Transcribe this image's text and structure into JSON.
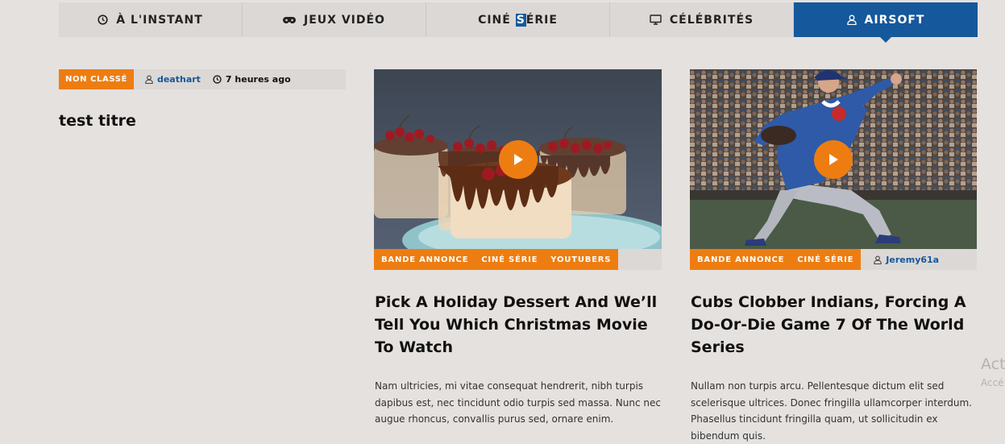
{
  "nav": {
    "tabs": [
      {
        "label": "À L'INSTANT",
        "icon": "clock-icon"
      },
      {
        "label": "JEUX VIDÉO",
        "icon": "gamepad-icon"
      },
      {
        "label_before": "CINÉ ",
        "label_hl": "S",
        "label_after": "ÉRIE"
      },
      {
        "label": "CÉLÉBRITÉS",
        "icon": "monitor-icon"
      },
      {
        "label": "AIRSOFT",
        "icon": "user-icon",
        "active": true
      }
    ]
  },
  "left_post": {
    "category": "NON CLASSÉ",
    "author": "deathart",
    "time": "7 heures ago",
    "title": "test titre"
  },
  "cards": [
    {
      "tags": [
        "BANDE ANNONCE",
        "CINÉ SÉRIE",
        "YOUTUBERS"
      ],
      "title": "Pick A Holiday Dessert And We’ll Tell You Which Christmas Movie To Watch",
      "excerpt": "Nam ultricies, mi vitae consequat hendrerit, nibh turpis dapibus est, nec tincidunt odio turpis sed massa. Nunc nec augue rhoncus, convallis purus sed, ornare enim."
    },
    {
      "tags": [
        "BANDE ANNONCE",
        "CINÉ SÉRIE"
      ],
      "author": "Jeremy61a",
      "title": "Cubs Clobber Indians, Forcing A Do-Or-Die Game 7 Of The World Series",
      "excerpt": "Nullam non turpis arcu. Pellentesque dictum elit sed scelerisque ultrices. Donec fringilla ullamcorper interdum. Phasellus tincidunt fringilla quam, ut sollicitudin ex bibendum quis."
    }
  ],
  "watermark": {
    "line1": "Act",
    "line2": "Accé"
  },
  "colors": {
    "accent": "#ee7d11",
    "brand": "#15589b",
    "background": "#e5e1de",
    "bar": "#dcd8d5"
  }
}
